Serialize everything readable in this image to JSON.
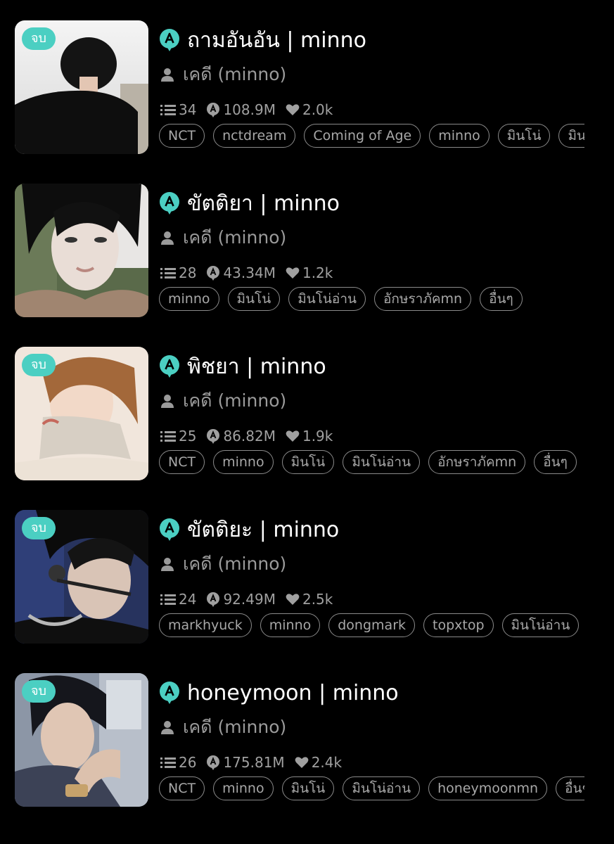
{
  "items": [
    {
      "badge": "จบ",
      "title": "ถามอันอัน | minno",
      "author": "เคดี (minno)",
      "chapters": "34",
      "views": "108.9M",
      "likes": "2.0k",
      "tags": [
        "NCT",
        "nctdream",
        "Coming of Age",
        "minno",
        "มินโน่",
        "มินโน่อ่าน"
      ]
    },
    {
      "badge": "",
      "title": "ขัตติยา | minno",
      "author": "เคดี (minno)",
      "chapters": "28",
      "views": "43.34M",
      "likes": "1.2k",
      "tags": [
        "minno",
        "มินโน่",
        "มินโน่อ่าน",
        "อักษราภัคmn",
        "อื่นๆ"
      ]
    },
    {
      "badge": "จบ",
      "title": "พิชยา | minno",
      "author": "เคดี (minno)",
      "chapters": "25",
      "views": "86.82M",
      "likes": "1.9k",
      "tags": [
        "NCT",
        "minno",
        "มินโน่",
        "มินโน่อ่าน",
        "อักษราภัคmn",
        "อื่นๆ"
      ]
    },
    {
      "badge": "จบ",
      "title": "ขัตติยะ | minno",
      "author": "เคดี (minno)",
      "chapters": "24",
      "views": "92.49M",
      "likes": "2.5k",
      "tags": [
        "markhyuck",
        "minno",
        "dongmark",
        "topxtop",
        "มินโน่อ่าน"
      ]
    },
    {
      "badge": "จบ",
      "title": "honeymoon | minno",
      "author": "เคดี (minno)",
      "chapters": "26",
      "views": "175.81M",
      "likes": "2.4k",
      "tags": [
        "NCT",
        "minno",
        "มินโน่",
        "มินโน่อ่าน",
        "honeymoonmn",
        "อื่นๆ"
      ]
    }
  ],
  "colors": {
    "accent": "#4bcfc2",
    "background": "#000000",
    "muted_text": "#9a9a9a"
  },
  "icons": {
    "brand": "a-bubble-icon",
    "author": "person-icon",
    "chapters": "list-icon",
    "views": "views-bubble-icon",
    "likes": "heart-icon"
  }
}
